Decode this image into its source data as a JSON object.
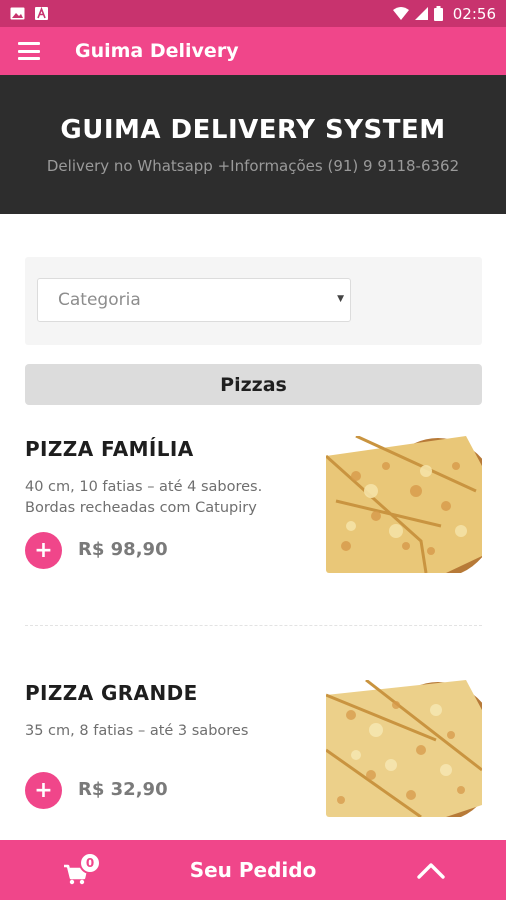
{
  "status_bar": {
    "time": "02:56",
    "left_icons": [
      "image-icon",
      "text-a-icon"
    ],
    "right_icons": [
      "wifi-icon",
      "signal-icon",
      "battery-icon"
    ]
  },
  "app_bar": {
    "title": "Guima Delivery",
    "menu_icon": "hamburger-menu-icon"
  },
  "hero": {
    "title": "GUIMA DELIVERY SYSTEM",
    "subtitle": "Delivery no Whatsapp +Informações (91) 9 9118-6362"
  },
  "filter": {
    "category_placeholder": "Categoria"
  },
  "category": {
    "name": "Pizzas"
  },
  "products": [
    {
      "name": "PIZZA FAMÍLIA",
      "description": "40 cm, 10 fatias – até 4 sabores. Bordas recheadas com Catupiry",
      "price": "R$ 98,90",
      "add_label": "+"
    },
    {
      "name": "PIZZA GRANDE",
      "description": "35 cm, 8 fatias – até 3 sabores",
      "price": "R$ 32,90",
      "add_label": "+"
    }
  ],
  "bottom_bar": {
    "label": "Seu Pedido",
    "cart_count": "0"
  },
  "colors": {
    "status_bar": "#c8336e",
    "accent": "#f0468a",
    "hero_bg": "#2d2d2d"
  }
}
